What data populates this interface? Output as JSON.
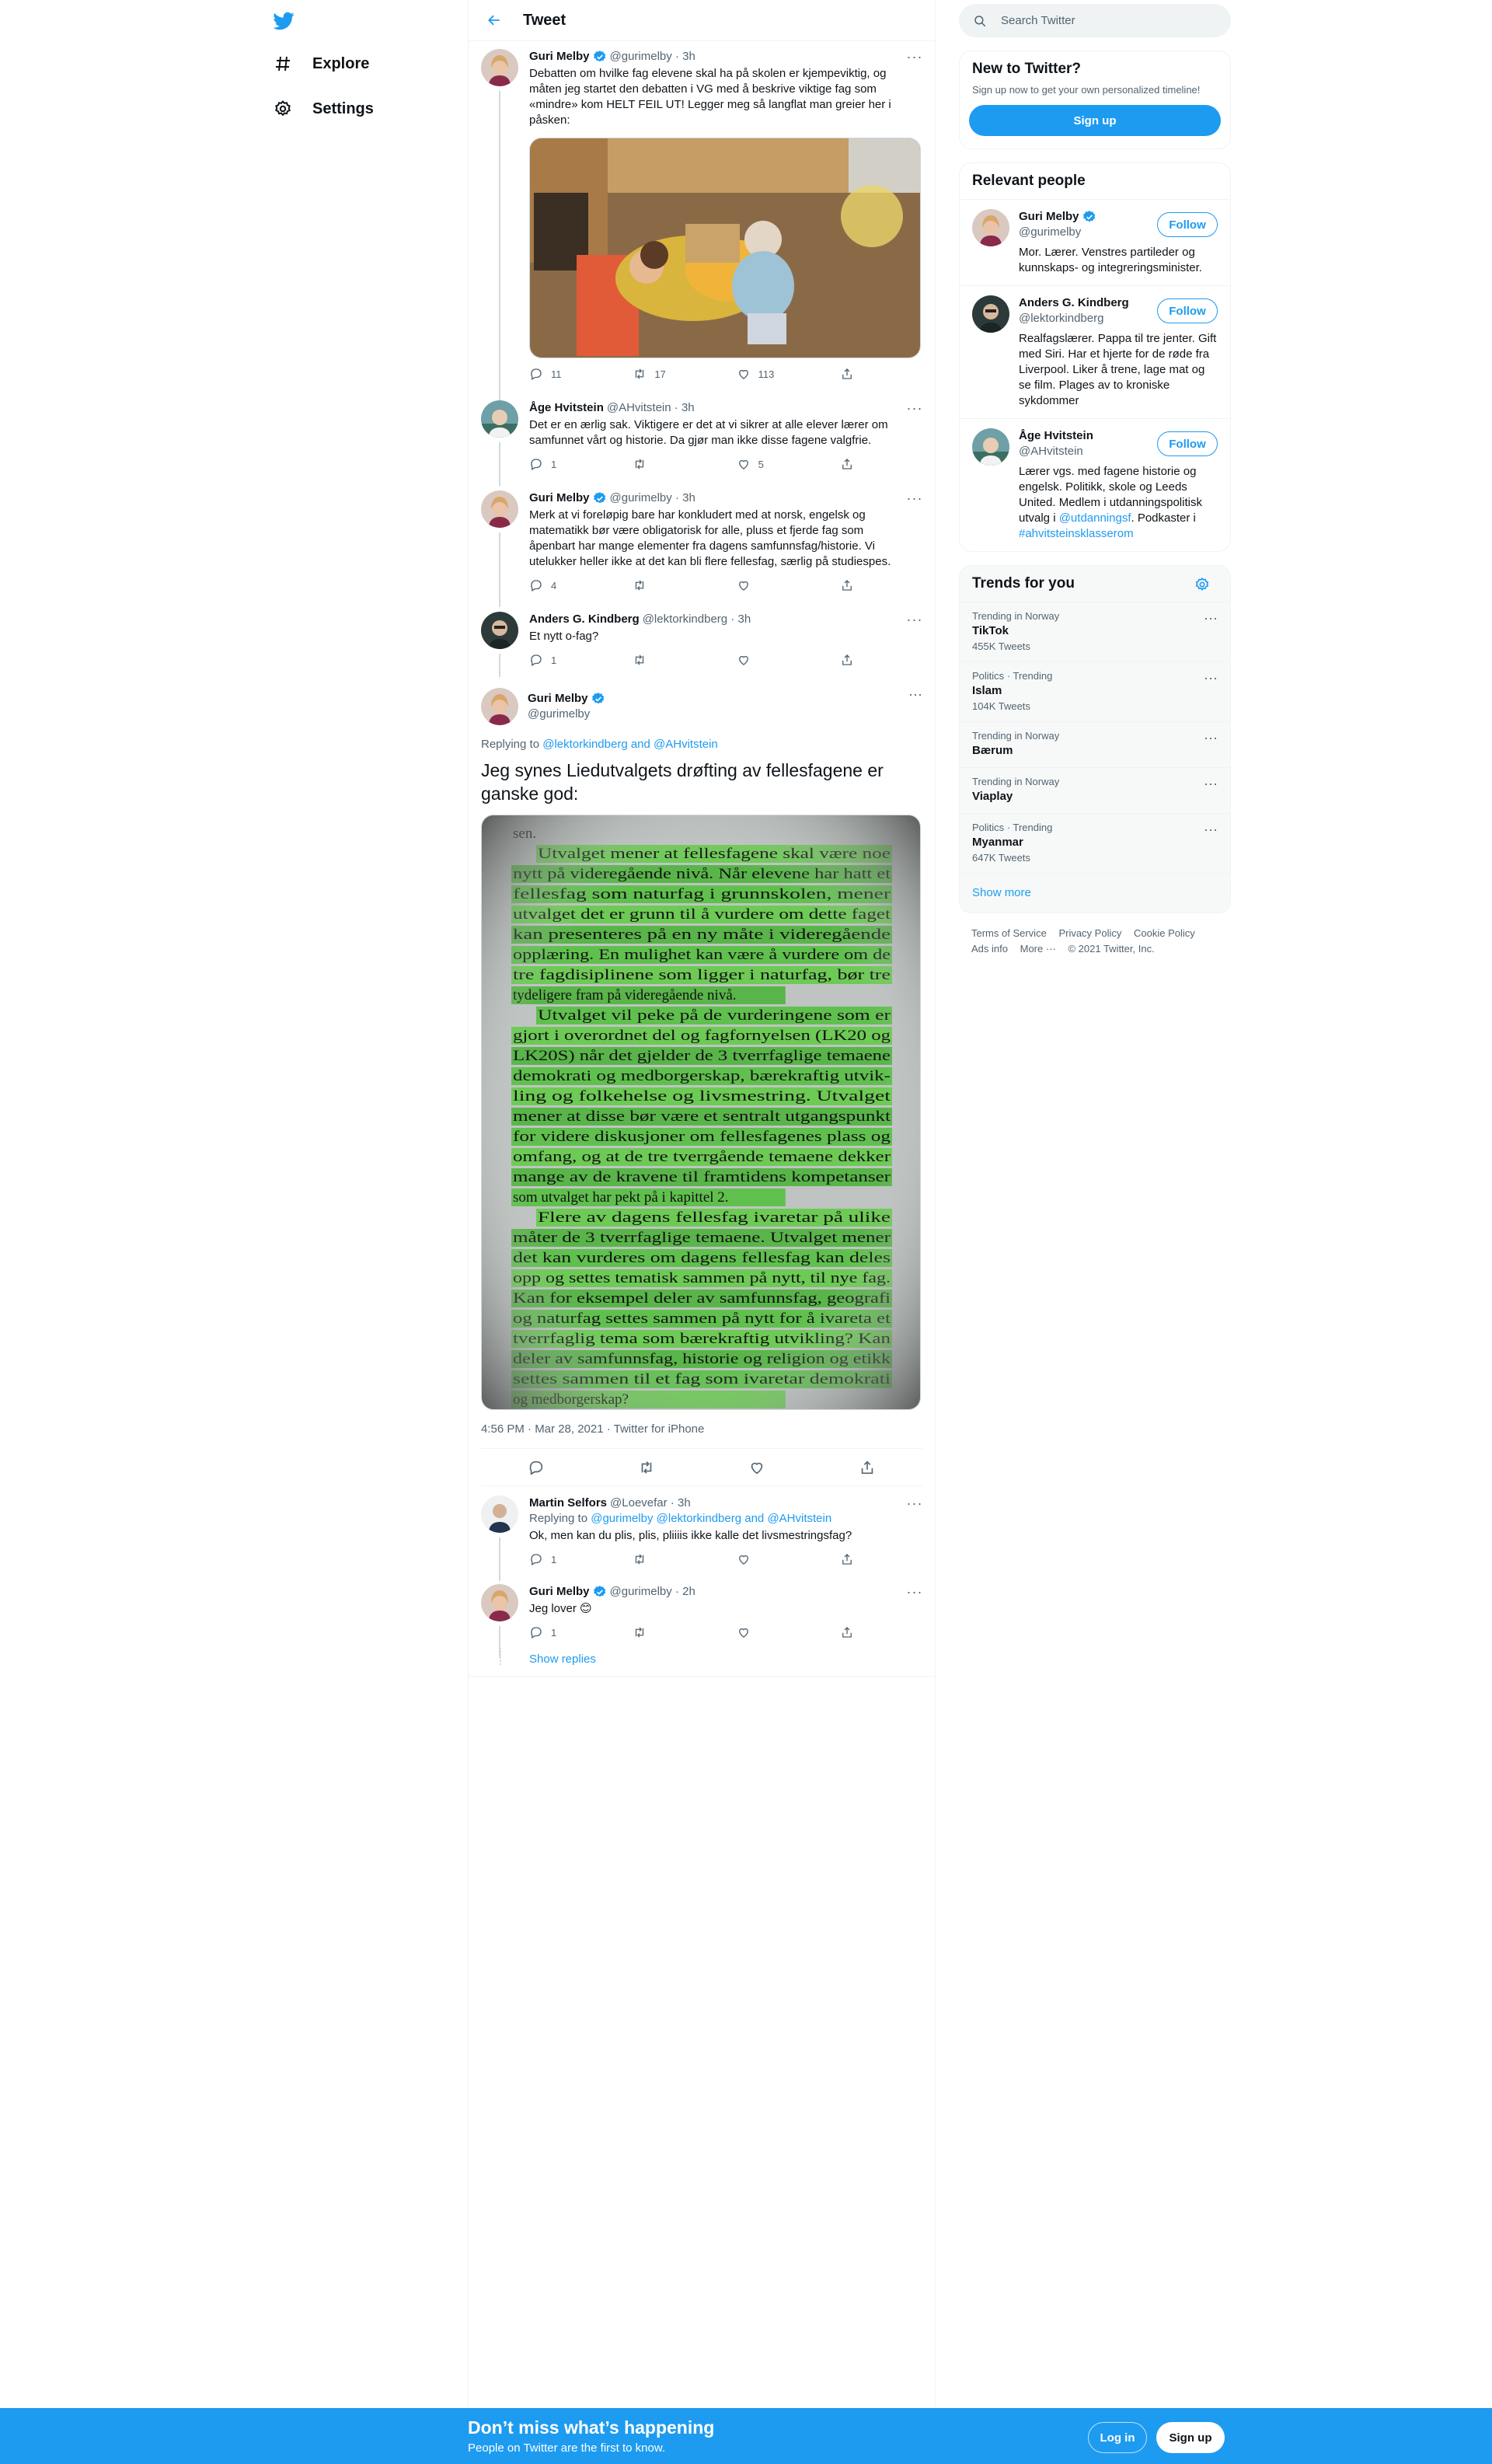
{
  "nav": {
    "logo": "twitter-logo-icon",
    "items": [
      {
        "label": "Explore",
        "icon": "hashtag-icon"
      },
      {
        "label": "Settings",
        "icon": "gear-icon"
      }
    ]
  },
  "header": {
    "title": "Tweet",
    "back_icon": "arrow-left-icon"
  },
  "thread": [
    {
      "name": "Guri Melby",
      "verified": true,
      "handle": "@gurimelby",
      "time": "3h",
      "text": "Debatten om hvilke fag elevene skal ha på skolen er kjempeviktig, og måten jeg startet den debatten i VG med å beskrive viktige fag som «mindre» kom HELT FEIL UT! Legger meg så langflat man greier her i påsken:",
      "reply": "11",
      "retweet": "17",
      "like": "113"
    },
    {
      "name": "Åge Hvitstein",
      "handle": "@AHvitstein",
      "time": "3h",
      "text": "Det er en ærlig sak. Viktigere er det at vi sikrer at alle elever lærer om samfunnet vårt og historie. Da gjør man ikke disse fagene valgfrie.",
      "reply": "1",
      "retweet": "",
      "like": "5"
    },
    {
      "name": "Guri Melby",
      "verified": true,
      "handle": "@gurimelby",
      "time": "3h",
      "text": "Merk at vi foreløpig bare har konkludert med at norsk, engelsk og matematikk bør være obligatorisk for alle, pluss et fjerde fag som åpenbart har mange elementer fra dagens samfunnsfag/historie. Vi utelukker heller ikke at det kan bli flere fellesfag, særlig på studiespes.",
      "reply": "4",
      "retweet": "",
      "like": ""
    },
    {
      "name": "Anders G. Kindberg",
      "handle": "@lektorkindberg",
      "time": "3h",
      "text": "Et nytt o-fag?",
      "reply": "1",
      "retweet": "",
      "like": ""
    }
  ],
  "focal": {
    "name": "Guri Melby",
    "handle": "@gurimelby",
    "replying_prefix": "Replying to ",
    "replying_to": "@lektorkindberg and @AHvitstein",
    "text": "Jeg synes Liedutvalgets drøfting av fellesfagene er ganske god:",
    "timestamp": "4:56 PM · Mar 28, 2021 · Twitter for iPhone",
    "doc_lines": [
      "sen.",
      "Utvalget mener at fellesfagene skal være noe",
      "nytt på videregående nivå. Når elevene har hatt et",
      "fellesfag som naturfag i grunnskolen, mener",
      "utvalget det er grunn til å vurdere om dette faget",
      "kan presenteres på en ny måte i videregående",
      "opplæring. En mulighet kan være å vurdere om de",
      "tre fagdisiplinene som ligger i naturfag, bør tre",
      "tydeligere fram på videregående nivå.",
      "Utvalget vil peke på de vurderingene som er",
      "gjort i overordnet del og fagfornyelsen (LK20 og",
      "LK20S) når det gjelder de 3 tverrfaglige temaene",
      "demokrati og medborgerskap, bærekraftig utvik-",
      "ling og folkehelse og livsmestring. Utvalget",
      "mener at disse bør være et sentralt utgangspunkt",
      "for videre diskusjoner om fellesfagenes plass og",
      "omfang, og at de tre tverrgående temaene dekker",
      "mange av de kravene til framtidens kompetanser",
      "som utvalget har pekt på i kapittel 2.",
      "Flere av dagens fellesfag ivaretar på ulike",
      "måter de 3 tverrfaglige temaene. Utvalget mener",
      "det kan vurderes om dagens fellesfag kan deles",
      "opp og settes tematisk sammen på nytt, til nye fag.",
      "Kan for eksempel deler av samfunnsfag, geografi",
      "og naturfag settes sammen på nytt for å ivareta et",
      "tverrfaglig tema som bærekraftig utvikling? Kan",
      "deler av samfunnsfag, historie og religion og etikk",
      "settes sammen til et fag som ivaretar demokrati",
      "og medborgerskap?"
    ]
  },
  "replies": [
    {
      "name": "Martin Selfors",
      "handle": "@Loevefar",
      "time": "3h",
      "replying_prefix": "Replying to ",
      "replying_to": "@gurimelby @lektorkindberg and @AHvitstein",
      "text": "Ok, men kan du plis, plis, pliiiis ikke kalle det livsmestringsfag?",
      "reply": "1"
    },
    {
      "name": "Guri Melby",
      "verified": true,
      "handle": "@gurimelby",
      "time": "2h",
      "text": "Jeg lover 😊",
      "reply": "1"
    }
  ],
  "show_replies": "Show replies",
  "right": {
    "search_placeholder": "Search Twitter",
    "new_title": "New to Twitter?",
    "new_sub": "Sign up now to get your own personalized timeline!",
    "signup": "Sign up",
    "relevant_title": "Relevant people",
    "people": [
      {
        "name": "Guri Melby",
        "verified": true,
        "handle": "@gurimelby",
        "bio": "Mor. Lærer. Venstres partileder og kunnskaps- og integreringsminister.",
        "follow": "Follow"
      },
      {
        "name": "Anders G. Kindberg",
        "handle": "@lektorkindberg",
        "bio": "Realfagslærer. Pappa til tre jenter. Gift med Siri. Har et hjerte for de røde fra Liverpool. Liker å trene, lage mat og se film. Plages av to kroniske sykdommer",
        "follow": "Follow"
      },
      {
        "name": "Åge Hvitstein",
        "handle": "@AHvitstein",
        "bio_1": "Lærer vgs. med fagene historie og engelsk. Politikk, skole og Leeds United. Medlem i utdanningspolitisk utvalg i ",
        "bio_link1": "@utdanningsf",
        "bio_2": ". Podkaster i ",
        "bio_link2": "#ahvitsteinsklasserom",
        "follow": "Follow"
      }
    ],
    "trends_title": "Trends for you",
    "trends": [
      {
        "context": "Trending in Norway",
        "name": "TikTok",
        "count": "455K Tweets"
      },
      {
        "context": "Politics · Trending",
        "name": "Islam",
        "count": "104K Tweets"
      },
      {
        "context": "Trending in Norway",
        "name": "Bærum",
        "count": ""
      },
      {
        "context": "Trending in Norway",
        "name": "Viaplay",
        "count": ""
      },
      {
        "context": "Politics · Trending",
        "name": "Myanmar",
        "count": "647K Tweets"
      }
    ],
    "show_more": "Show more",
    "footer": [
      "Terms of Service",
      "Privacy Policy",
      "Cookie Policy",
      "Ads info",
      "More ···",
      "© 2021 Twitter, Inc."
    ]
  },
  "bottom": {
    "title": "Don’t miss what’s happening",
    "subtitle": "People on Twitter are the first to know.",
    "login": "Log in",
    "signup": "Sign up"
  },
  "colors": {
    "accent": "#1d9bf0",
    "text": "#0f1419",
    "muted": "#536471",
    "border": "#eff3f4"
  }
}
